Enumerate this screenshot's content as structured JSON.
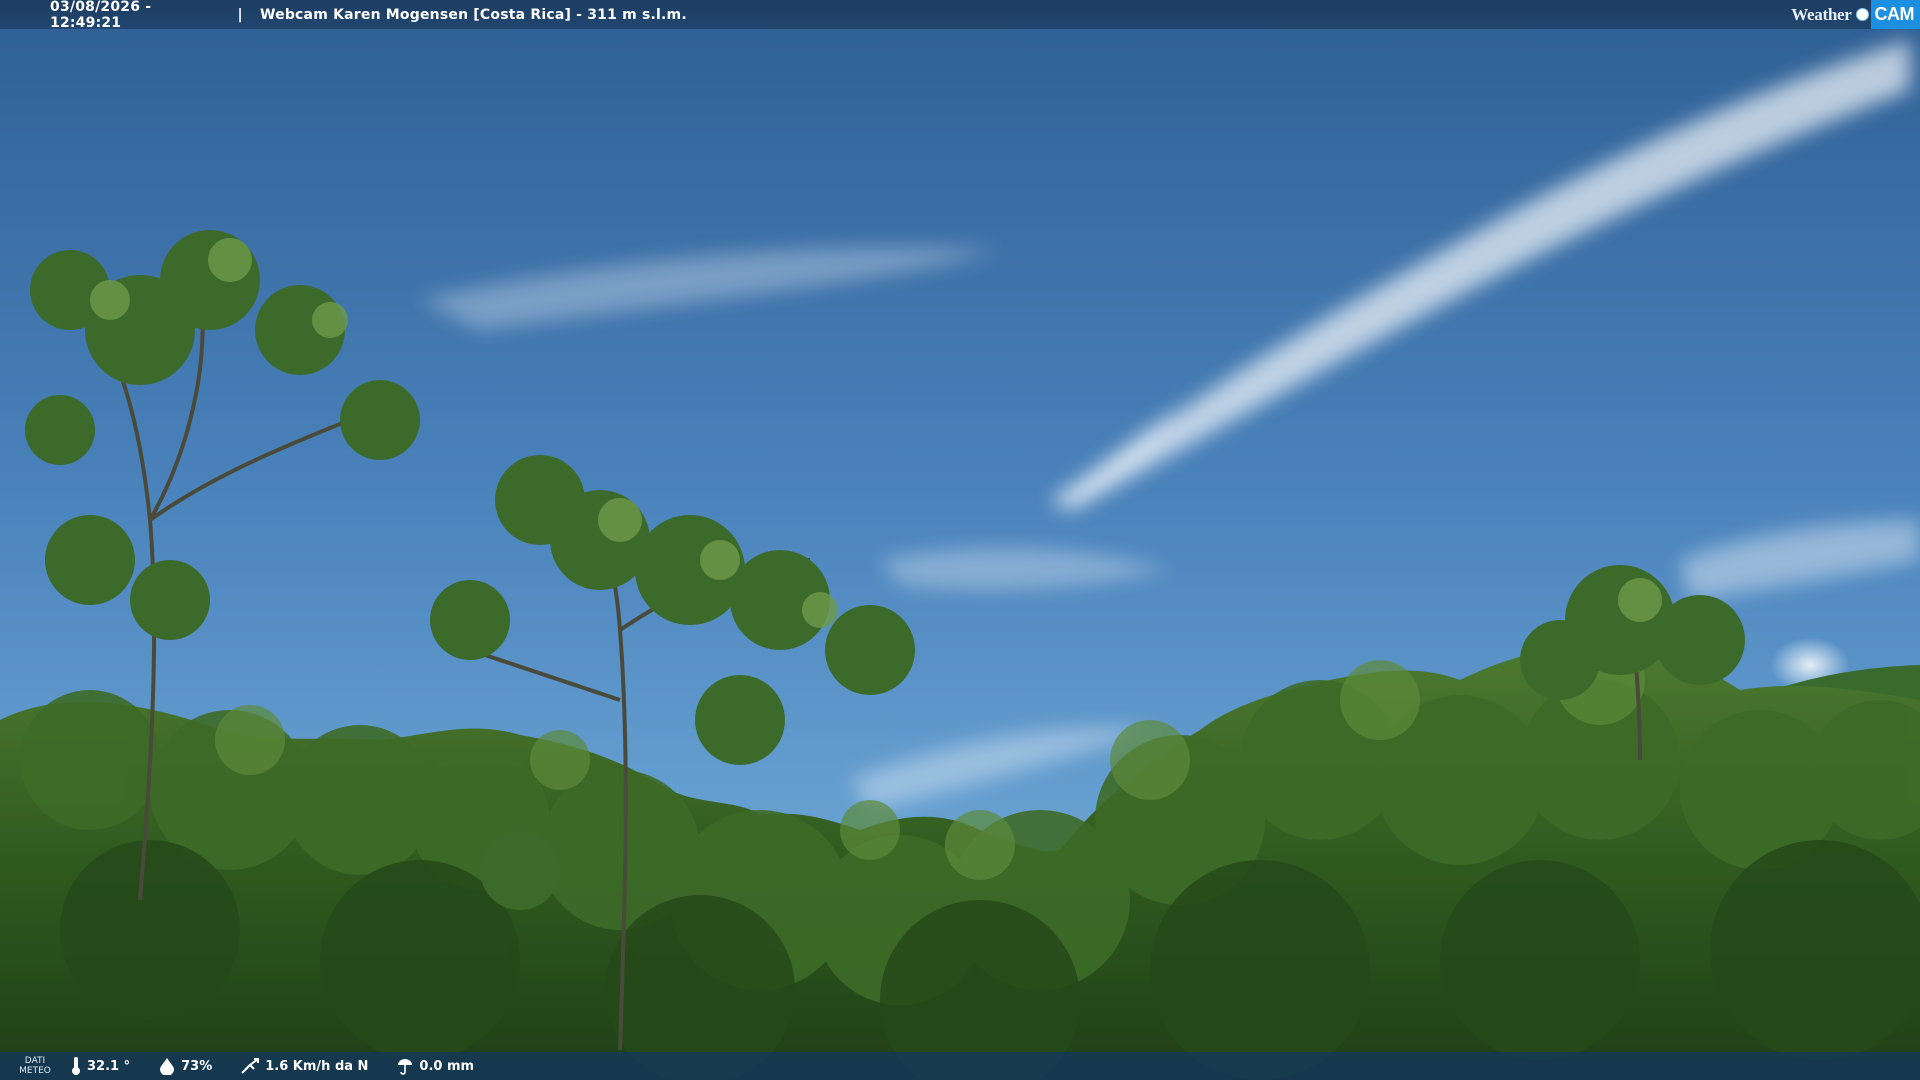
{
  "header": {
    "timestamp": "03/08/2026 - 12:49:21",
    "separator": "|",
    "title": "Webcam Karen Mogensen [Costa Rica] - 311 m s.l.m."
  },
  "brand": {
    "part1": "Weather",
    "part2": "CAM"
  },
  "weather": {
    "section_label_line1": "DATI",
    "section_label_line2": "METEO",
    "temperature": "32.1 °",
    "humidity": "73%",
    "wind": "1.6 Km/h da N",
    "rain": "0.0 mm"
  },
  "icons": [
    "thermometer-icon",
    "humidity-drop-icon",
    "wind-vane-icon",
    "rain-gauge-icon"
  ],
  "colors": {
    "sky_top": "#2f5f94",
    "sky_bottom": "#6ea6d6",
    "foliage": "#2f5a20",
    "bar": "#1f426b",
    "brand_accent": "#1d8fe0"
  }
}
